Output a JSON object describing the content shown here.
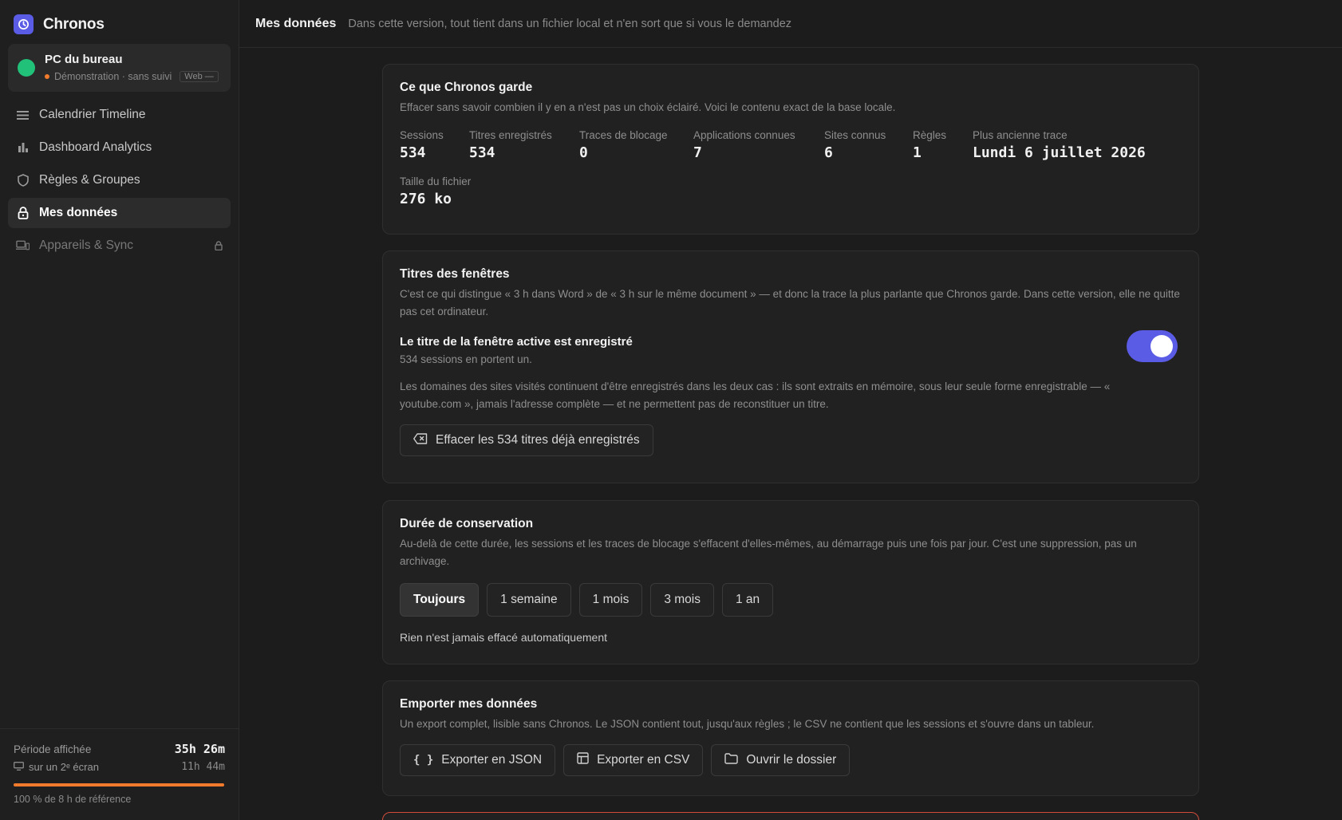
{
  "app": {
    "name": "Chronos"
  },
  "device": {
    "name": "PC du bureau",
    "status": "Démonstration · sans suivi",
    "badge": "Web —"
  },
  "nav": {
    "items": [
      {
        "label": "Calendrier Timeline",
        "icon": "timeline-icon"
      },
      {
        "label": "Dashboard Analytics",
        "icon": "bar-chart-icon"
      },
      {
        "label": "Règles & Groupes",
        "icon": "shield-icon"
      },
      {
        "label": "Mes données",
        "icon": "lock-icon"
      },
      {
        "label": "Appareils & Sync",
        "icon": "devices-icon"
      }
    ]
  },
  "footer": {
    "period_label": "Période affichée",
    "period_value": "35h 26m",
    "second_screen_label": "sur un 2ᵉ écran",
    "second_screen_value": "11h 44m",
    "progress_percent": 100,
    "progress_color": "#f07b2c",
    "reference_note": "100 % de 8 h de référence"
  },
  "header": {
    "title": "Mes données",
    "subtitle": "Dans cette version, tout tient dans un fichier local et n'en sort que si vous le demandez"
  },
  "kept": {
    "title": "Ce que Chronos garde",
    "description": "Effacer sans savoir combien il y en a n'est pas un choix éclairé. Voici le contenu exact de la base locale.",
    "stats": [
      {
        "label": "Sessions",
        "value": "534"
      },
      {
        "label": "Titres enregistrés",
        "value": "534"
      },
      {
        "label": "Traces de blocage",
        "value": "0"
      },
      {
        "label": "Applications connues",
        "value": "7"
      },
      {
        "label": "Sites connus",
        "value": "6"
      },
      {
        "label": "Règles",
        "value": "1"
      },
      {
        "label": "Plus ancienne trace",
        "value": "Lundi 6 juillet 2026"
      }
    ],
    "file_size_label": "Taille du fichier",
    "file_size_value": "276 ko"
  },
  "titles": {
    "title": "Titres des fenêtres",
    "description": "C'est ce qui distingue « 3 h dans Word » de « 3 h sur le même document » — et donc la trace la plus parlante que Chronos garde. Dans cette version, elle ne quitte pas cet ordinateur.",
    "setting_title": "Le titre de la fenêtre active est enregistré",
    "setting_sub": "534 sessions en portent un.",
    "toggle_on": true,
    "toggle_color": "#5b5ce6",
    "domains_note": "Les domaines des sites visités continuent d'être enregistrés dans les deux cas : ils sont extraits en mémoire, sous leur seule forme enregistrable — « youtube.com », jamais l'adresse complète — et ne permettent pas de reconstituer un titre.",
    "erase_button": "Effacer les 534 titres déjà enregistrés"
  },
  "retention": {
    "title": "Durée de conservation",
    "description": "Au-delà de cette durée, les sessions et les traces de blocage s'effacent d'elles-mêmes, au démarrage puis une fois par jour. C'est une suppression, pas un archivage.",
    "options": [
      "Toujours",
      "1 semaine",
      "1 mois",
      "3 mois",
      "1 an"
    ],
    "selected": "Toujours",
    "note": "Rien n'est jamais effacé automatiquement"
  },
  "export": {
    "title": "Emporter mes données",
    "description": "Un export complet, lisible sans Chronos. Le JSON contient tout, jusqu'aux règles ; le CSV ne contient que les sessions et s'ouvre dans un tableur.",
    "json_button": "Exporter en JSON",
    "csv_button": "Exporter en CSV",
    "folder_button": "Ouvrir le dossier"
  },
  "colors": {
    "accent": "#5b5ce6",
    "success": "#22c17a",
    "warning": "#f07b2c",
    "danger": "#d24b3a"
  }
}
